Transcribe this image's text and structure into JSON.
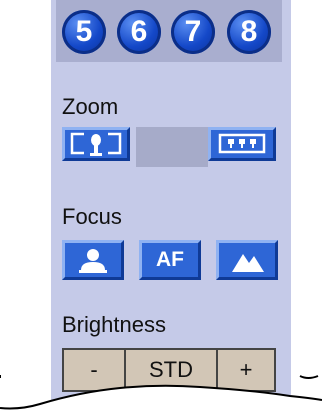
{
  "presets": [
    {
      "label": "5"
    },
    {
      "label": "6"
    },
    {
      "label": "7"
    },
    {
      "label": "8"
    }
  ],
  "zoom": {
    "label": "Zoom",
    "wide_icon": "zoom-wide-icon",
    "tele_icon": "zoom-tele-icon"
  },
  "focus": {
    "label": "Focus",
    "near_icon": "focus-near-icon",
    "af_label": "AF",
    "far_icon": "focus-far-icon"
  },
  "brightness": {
    "label": "Brightness",
    "minus_label": "-",
    "std_label": "STD",
    "plus_label": "+"
  },
  "colors": {
    "panel": "#c5cae8",
    "button_blue": "#2e66d6",
    "preset_blue": "#1448c8"
  }
}
